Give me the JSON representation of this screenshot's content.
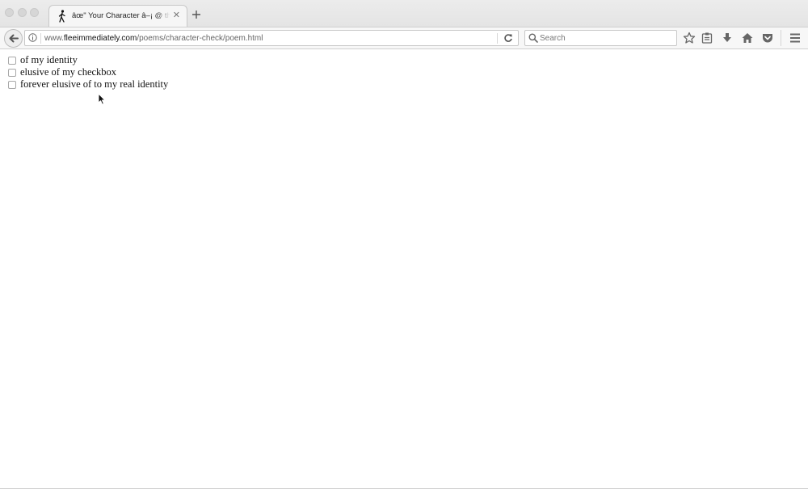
{
  "window": {
    "colors": {
      "tabbar_bg": "#e4e4e4",
      "toolbar_bg": "#f7f7f7",
      "content_bg": "#ffffff",
      "icon_gray": "#6b6b6b"
    }
  },
  "tab": {
    "favicon": "walking-person-icon",
    "title": "âœ\" Your Character â–¡ @ the a",
    "close_glyph": "✕"
  },
  "toolbar": {
    "url_prefix": "www.",
    "url_host": "fleeimmediately.com",
    "url_path": "/poems/character-check/poem.html",
    "search_placeholder": "Search",
    "icons": [
      "back-arrow-icon",
      "info-icon",
      "reload-icon",
      "search-icon",
      "bookmark-star-icon",
      "reading-list-icon",
      "download-icon",
      "home-icon",
      "pocket-icon",
      "hamburger-menu-icon"
    ]
  },
  "poem": {
    "lines": [
      {
        "text": "of my identity",
        "checked": false
      },
      {
        "text": "elusive of my checkbox",
        "checked": false
      },
      {
        "text": "forever elusive of to my real identity",
        "checked": false
      }
    ]
  }
}
